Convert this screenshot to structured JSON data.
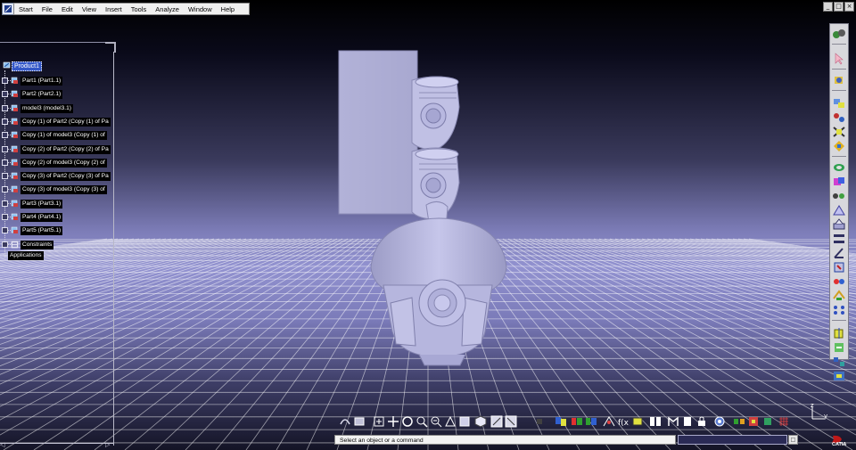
{
  "menubar": {
    "items": [
      "Start",
      "File",
      "Edit",
      "View",
      "Insert",
      "Tools",
      "Analyze",
      "Window",
      "Help"
    ]
  },
  "window_controls": [
    "_",
    "□",
    "×"
  ],
  "tree": {
    "root_label": "Product1",
    "items": [
      {
        "label": "Part1 (Part1.1)",
        "icon": "part-icon"
      },
      {
        "label": "Part2 (Part2.1)",
        "icon": "part-icon"
      },
      {
        "label": "model3 (model3.1)",
        "icon": "part-icon"
      },
      {
        "label": "Copy (1) of Part2 (Copy (1) of Pa",
        "icon": "part-icon"
      },
      {
        "label": "Copy (1) of model3 (Copy (1) of",
        "icon": "part-icon"
      },
      {
        "label": "Copy (2) of Part2 (Copy (2) of Pa",
        "icon": "part-icon"
      },
      {
        "label": "Copy (2) of model3 (Copy (2) of",
        "icon": "part-icon"
      },
      {
        "label": "Copy (3) of Part2 (Copy (3) of Pa",
        "icon": "part-icon"
      },
      {
        "label": "Copy (3) of model3 (Copy (3) of",
        "icon": "part-icon"
      },
      {
        "label": "Part3 (Part3.1)",
        "icon": "part-icon"
      },
      {
        "label": "Part4 (Part4.1)",
        "icon": "part-icon"
      },
      {
        "label": "Part5 (Part5.1)",
        "icon": "part-icon"
      },
      {
        "label": "Constraints",
        "icon": "constraints-icon"
      }
    ],
    "applications_label": "Applications"
  },
  "status": {
    "message": "Select an object or a command",
    "input_value": ""
  },
  "axis": {
    "z": "z",
    "y": "y"
  },
  "logo_text": "CATIA",
  "colors": {
    "background_top": "#000000",
    "background_horizon": "#9292d0",
    "grid": "#ffffff",
    "model": "#b4b4dc",
    "selection": "#3458c8"
  }
}
